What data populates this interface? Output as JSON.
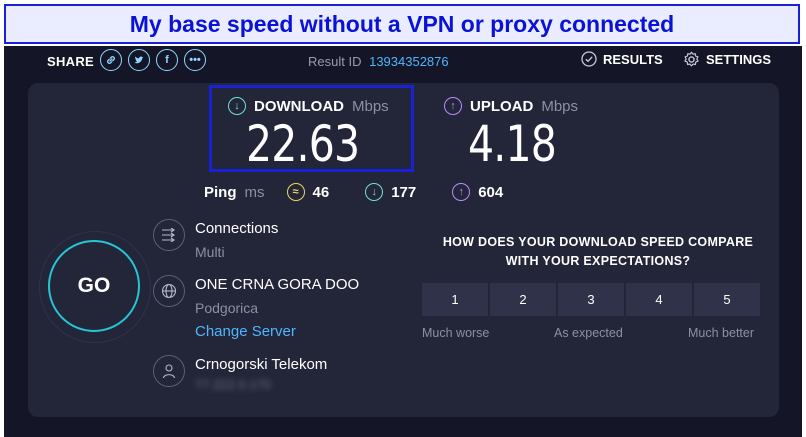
{
  "banner": {
    "text": "My base speed without a VPN or proxy connected"
  },
  "topbar": {
    "share_label": "SHARE",
    "share_icons": [
      "link-icon",
      "twitter-icon",
      "facebook-icon",
      "more-icon"
    ],
    "result_id_label": "Result ID",
    "result_id_value": "13934352876",
    "results_label": "RESULTS",
    "settings_label": "SETTINGS"
  },
  "download": {
    "label": "DOWNLOAD",
    "unit": "Mbps",
    "value": "22.63"
  },
  "upload": {
    "label": "UPLOAD",
    "unit": "Mbps",
    "value": "4.18"
  },
  "ping": {
    "label": "Ping",
    "unit": "ms",
    "idle": "46",
    "download": "177",
    "upload": "604"
  },
  "go": {
    "label": "GO"
  },
  "connections": {
    "title": "Connections",
    "value": "Multi"
  },
  "server": {
    "name": "ONE CRNA GORA DOO",
    "location": "Podgorica",
    "change_label": "Change Server"
  },
  "provider": {
    "name": "Crnogorski Telekom",
    "ip": "77.222.0.170"
  },
  "survey": {
    "question_line1": "HOW DOES YOUR DOWNLOAD SPEED COMPARE",
    "question_line2": "WITH YOUR EXPECTATIONS?",
    "options": [
      "1",
      "2",
      "3",
      "4",
      "5"
    ],
    "label_low": "Much worse",
    "label_mid": "As expected",
    "label_high": "Much better"
  },
  "colors": {
    "accent_blue": "#4fb6ff",
    "download_teal": "#6fe0d4",
    "upload_purple": "#b78cff",
    "ping_yellow": "#f3d35b",
    "go_ring": "#25c7d6",
    "annotation_blue": "#1a20d4"
  }
}
